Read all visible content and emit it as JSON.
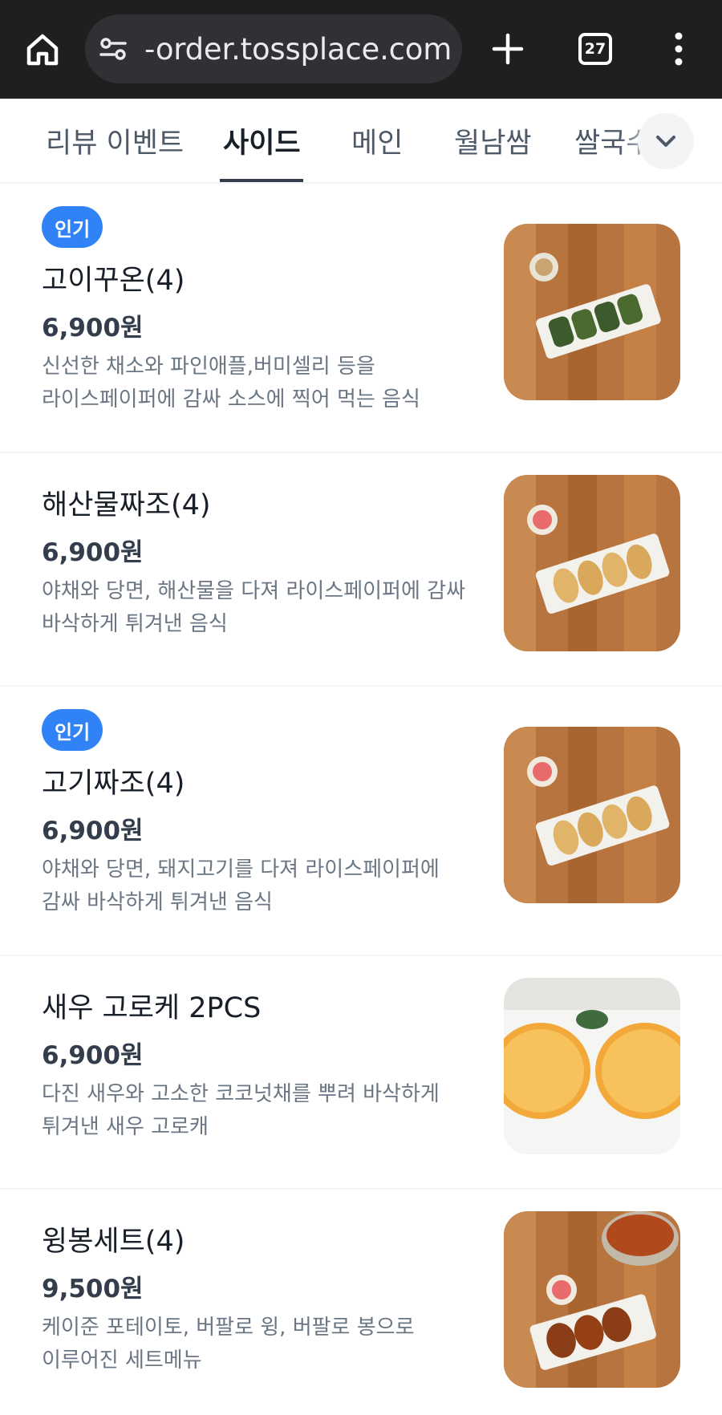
{
  "browser": {
    "url": "-order.tossplace.com",
    "tab_count": "27",
    "icons": [
      "home-icon",
      "tune-icon",
      "plus-icon",
      "tab-switcher-icon",
      "more-vert-icon"
    ]
  },
  "categories": {
    "tabs": [
      {
        "label": "리뷰 이벤트",
        "active": false
      },
      {
        "label": "사이드",
        "active": true
      },
      {
        "label": "메인",
        "active": false
      },
      {
        "label": "월남쌈",
        "active": false
      },
      {
        "label": "쌀국수",
        "active": false
      }
    ]
  },
  "colors": {
    "accent_badge": "#3182f6",
    "text_primary": "#191f28",
    "text_secondary": "#6b7684",
    "browser_bar": "#1f1f1f"
  },
  "menu": {
    "items": [
      {
        "badge": "인기",
        "name": "고이꾸온(4)",
        "price": "6,900원",
        "desc_line1": "신선한 채소와 파인애플,버미셀리 등을",
        "desc_line2": "라이스페이퍼에 감싸 소스에 찍어 먹는 음식"
      },
      {
        "badge": "",
        "name": "해산물짜조(4)",
        "price": "6,900원",
        "desc_line1": "야채와 당면, 해산물을 다져 라이스페이퍼에 감싸",
        "desc_line2": "바삭하게 튀겨낸 음식"
      },
      {
        "badge": "인기",
        "name": "고기짜조(4)",
        "price": "6,900원",
        "desc_line1": "야채와 당면, 돼지고기를 다져 라이스페이퍼에",
        "desc_line2": "감싸 바삭하게 튀겨낸 음식"
      },
      {
        "badge": "",
        "name": "새우 고로케 2PCS",
        "price": "6,900원",
        "desc_line1": "다진 새우와 고소한 코코넛채를 뿌려 바삭하게",
        "desc_line2": "튀겨낸 새우 고로캐"
      },
      {
        "badge": "",
        "name": "윙봉세트(4)",
        "price": "9,500원",
        "desc_line1": "케이준 포테이토, 버팔로 윙, 버팔로 봉으로",
        "desc_line2": "이루어진 세트메뉴"
      }
    ]
  }
}
